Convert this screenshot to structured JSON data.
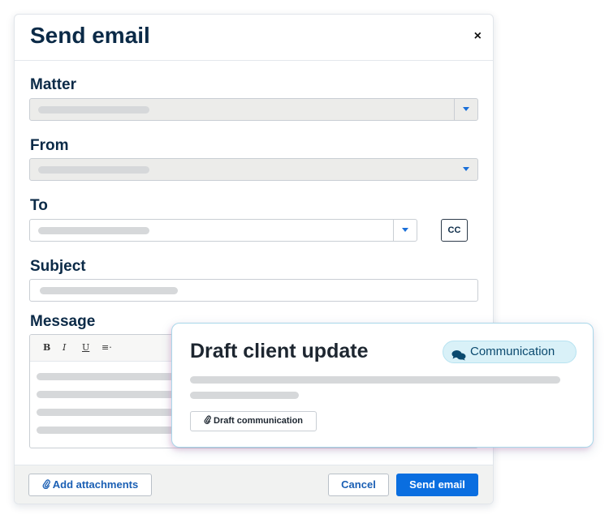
{
  "dialog": {
    "title": "Send email",
    "close_glyph": "×"
  },
  "fields": {
    "matter_label": "Matter",
    "from_label": "From",
    "to_label": "To",
    "cc_label": "CC",
    "subject_label": "Subject",
    "message_label": "Message"
  },
  "toolbar": {
    "bold": "B",
    "italic": "I",
    "underline": "U",
    "align": "≡·"
  },
  "footer": {
    "add_attachments": "Add attachments",
    "cancel": "Cancel",
    "send": "Send email"
  },
  "card": {
    "title": "Draft client update",
    "tag": "Communication",
    "action": "Draft communication"
  },
  "icons": {
    "close": "close-icon",
    "dropdown": "chevron-down-icon",
    "paperclip": "paperclip-icon",
    "chat": "chat-bubbles-icon"
  },
  "colors": {
    "primary": "#0a6ee0",
    "heading": "#0b2a47",
    "tag_bg": "#d9f1f8"
  }
}
